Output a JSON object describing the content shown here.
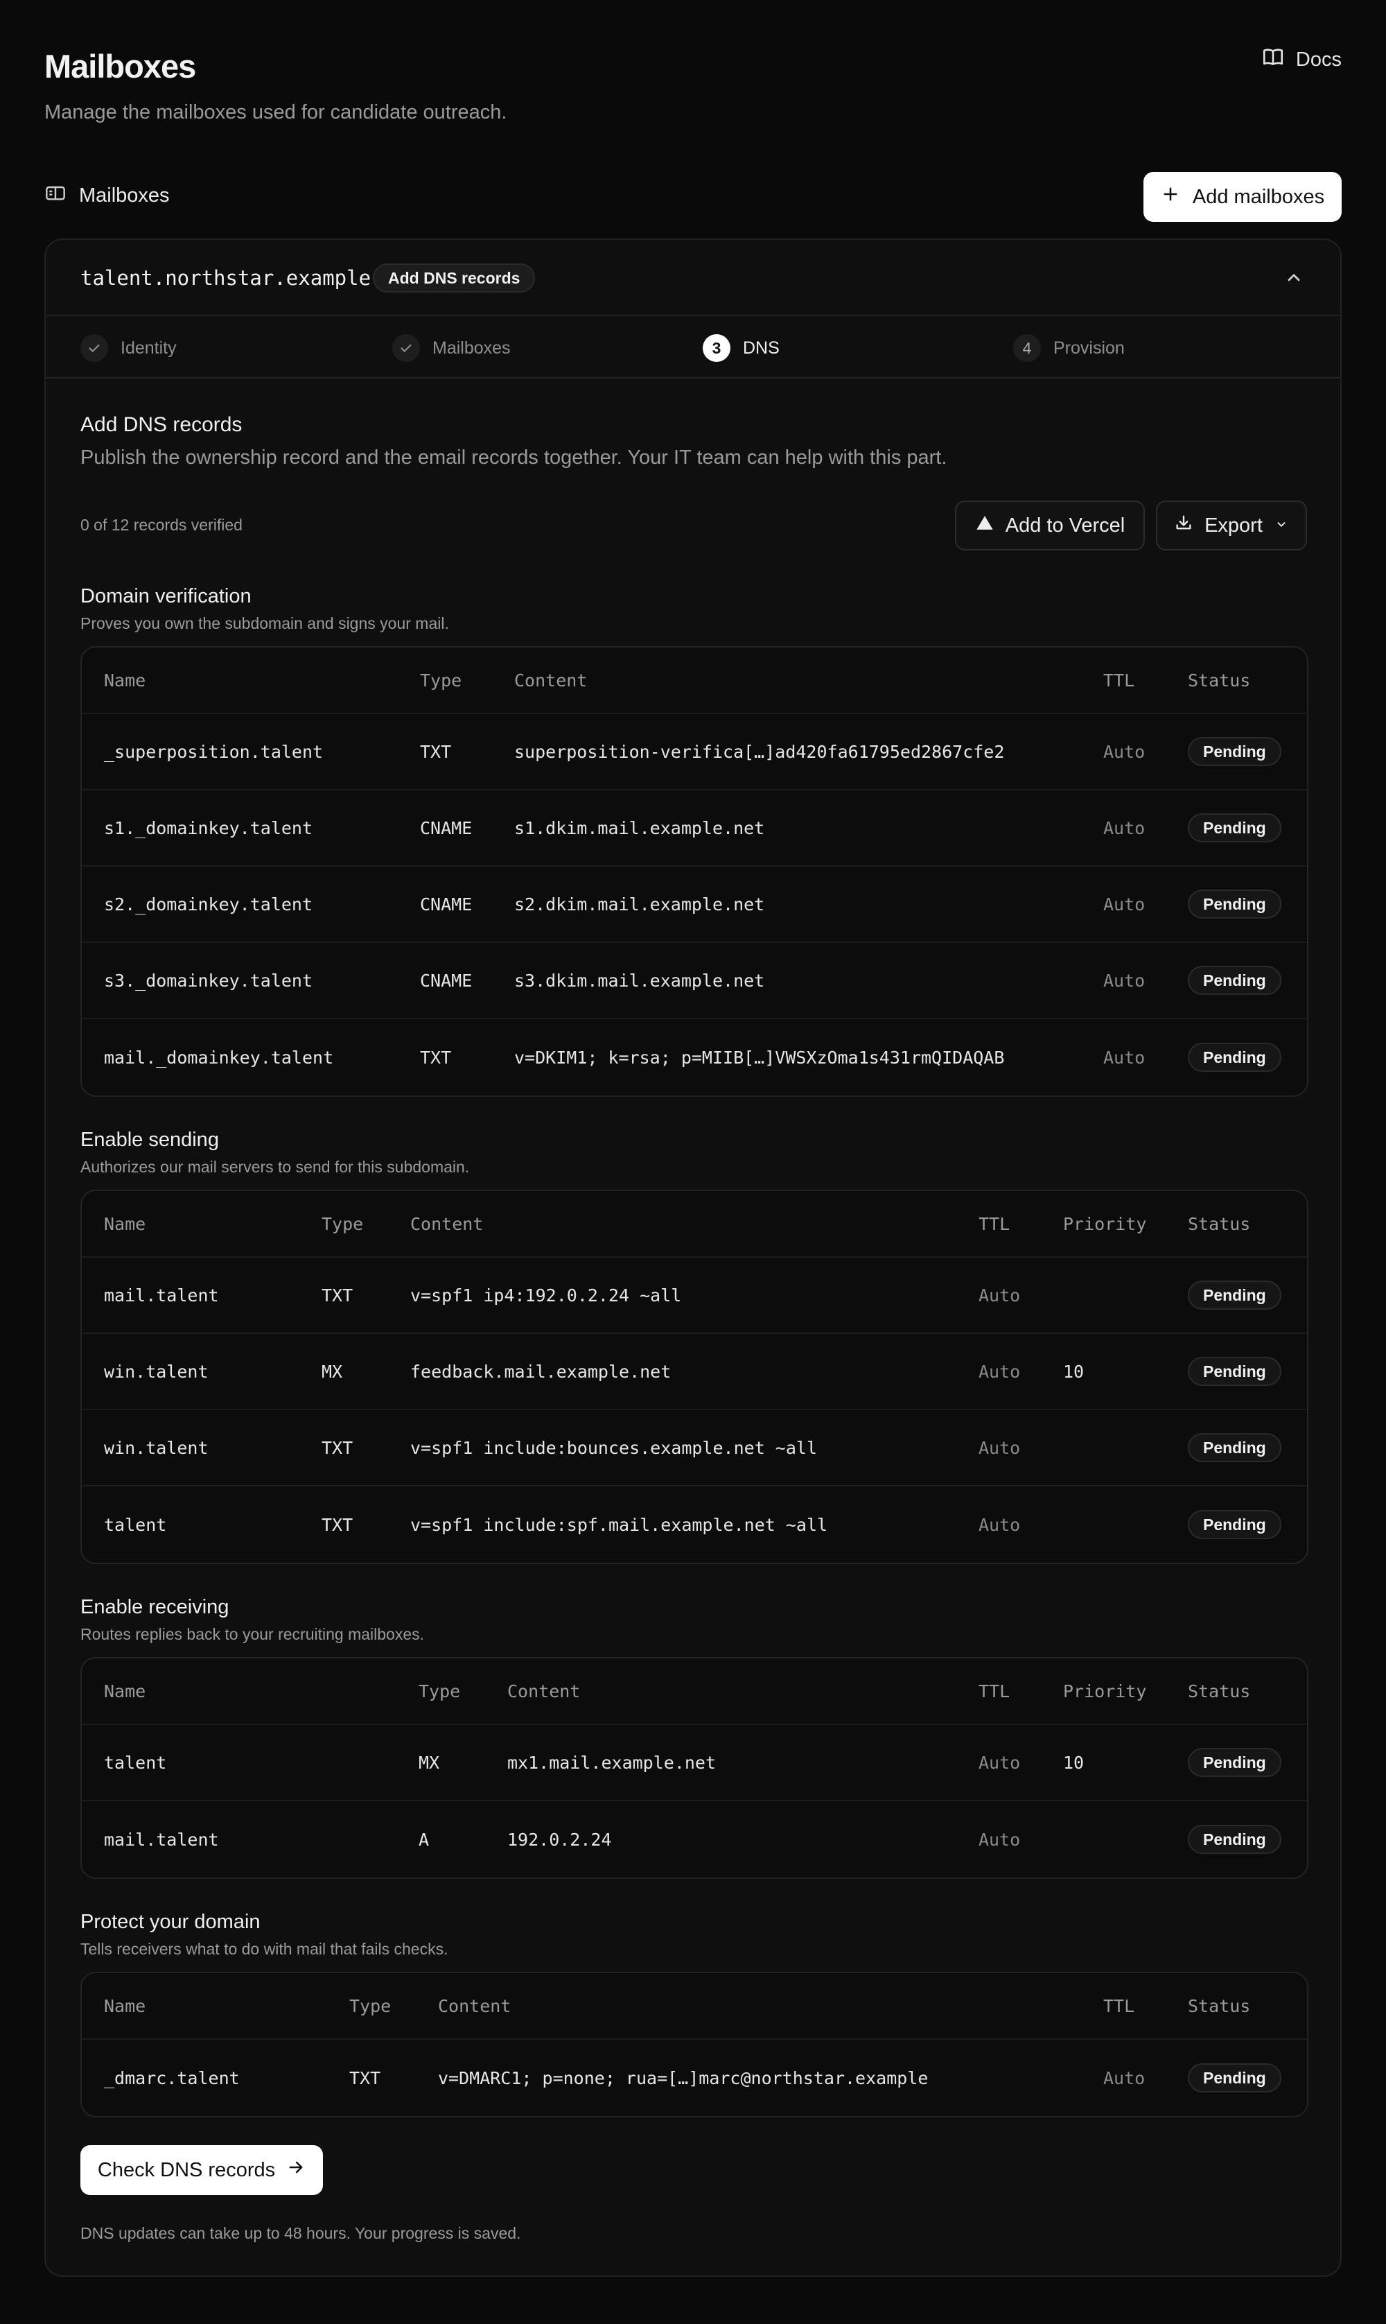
{
  "header": {
    "title": "Mailboxes",
    "subtitle": "Manage the mailboxes used for candidate outreach.",
    "docs_label": "Docs"
  },
  "section": {
    "label": "Mailboxes",
    "add_button": "Add mailboxes"
  },
  "domain_card": {
    "domain": "talent.northstar.example",
    "badge": "Add DNS records",
    "steps": [
      {
        "label": "Identity",
        "state": "done",
        "num": ""
      },
      {
        "label": "Mailboxes",
        "state": "done",
        "num": ""
      },
      {
        "label": "DNS",
        "state": "active",
        "num": "3"
      },
      {
        "label": "Provision",
        "state": "todo",
        "num": "4"
      }
    ],
    "title": "Add DNS records",
    "description": "Publish the ownership record and the email records together. Your IT team can help with this part.",
    "progress": "0 of 12 records verified",
    "vercel_button": "Add to Vercel",
    "export_button": "Export",
    "groups": [
      {
        "title": "Domain verification",
        "subtitle": "Proves you own the subdomain and signs your mail.",
        "headers": {
          "name": "Name",
          "type": "Type",
          "content": "Content",
          "ttl": "TTL",
          "status": "Status"
        },
        "rows": [
          {
            "name": "_superposition.talent",
            "type": "TXT",
            "content": "superposition-verifica[…]ad420fa61795ed2867cfe2",
            "ttl": "Auto",
            "status": "Pending"
          },
          {
            "name": "s1._domainkey.talent",
            "type": "CNAME",
            "content": "s1.dkim.mail.example.net",
            "ttl": "Auto",
            "status": "Pending"
          },
          {
            "name": "s2._domainkey.talent",
            "type": "CNAME",
            "content": "s2.dkim.mail.example.net",
            "ttl": "Auto",
            "status": "Pending"
          },
          {
            "name": "s3._domainkey.talent",
            "type": "CNAME",
            "content": "s3.dkim.mail.example.net",
            "ttl": "Auto",
            "status": "Pending"
          },
          {
            "name": "mail._domainkey.talent",
            "type": "TXT",
            "content": "v=DKIM1; k=rsa; p=MIIB[…]VWSXzOma1s431rmQIDAQAB",
            "ttl": "Auto",
            "status": "Pending"
          }
        ]
      },
      {
        "title": "Enable sending",
        "subtitle": "Authorizes our mail servers to send for this subdomain.",
        "headers": {
          "name": "Name",
          "type": "Type",
          "content": "Content",
          "ttl": "TTL",
          "priority": "Priority",
          "status": "Status"
        },
        "rows": [
          {
            "name": "mail.talent",
            "type": "TXT",
            "content": "v=spf1 ip4:192.0.2.24 ~all",
            "ttl": "Auto",
            "priority": "",
            "status": "Pending"
          },
          {
            "name": "win.talent",
            "type": "MX",
            "content": "feedback.mail.example.net",
            "ttl": "Auto",
            "priority": "10",
            "status": "Pending"
          },
          {
            "name": "win.talent",
            "type": "TXT",
            "content": "v=spf1 include:bounces.example.net ~all",
            "ttl": "Auto",
            "priority": "",
            "status": "Pending"
          },
          {
            "name": "talent",
            "type": "TXT",
            "content": "v=spf1 include:spf.mail.example.net ~all",
            "ttl": "Auto",
            "priority": "",
            "status": "Pending"
          }
        ]
      },
      {
        "title": "Enable receiving",
        "subtitle": "Routes replies back to your recruiting mailboxes.",
        "headers": {
          "name": "Name",
          "type": "Type",
          "content": "Content",
          "ttl": "TTL",
          "priority": "Priority",
          "status": "Status"
        },
        "rows": [
          {
            "name": "talent",
            "type": "MX",
            "content": "mx1.mail.example.net",
            "ttl": "Auto",
            "priority": "10",
            "status": "Pending"
          },
          {
            "name": "mail.talent",
            "type": "A",
            "content": "192.0.2.24",
            "ttl": "Auto",
            "priority": "",
            "status": "Pending"
          }
        ]
      },
      {
        "title": "Protect your domain",
        "subtitle": "Tells receivers what to do with mail that fails checks.",
        "headers": {
          "name": "Name",
          "type": "Type",
          "content": "Content",
          "ttl": "TTL",
          "status": "Status"
        },
        "rows": [
          {
            "name": "_dmarc.talent",
            "type": "TXT",
            "content": "v=DMARC1; p=none; rua=[…]marc@northstar.example",
            "ttl": "Auto",
            "status": "Pending"
          }
        ]
      }
    ],
    "check_button": "Check DNS records",
    "footnote": "DNS updates can take up to 48 hours. Your progress is saved."
  }
}
